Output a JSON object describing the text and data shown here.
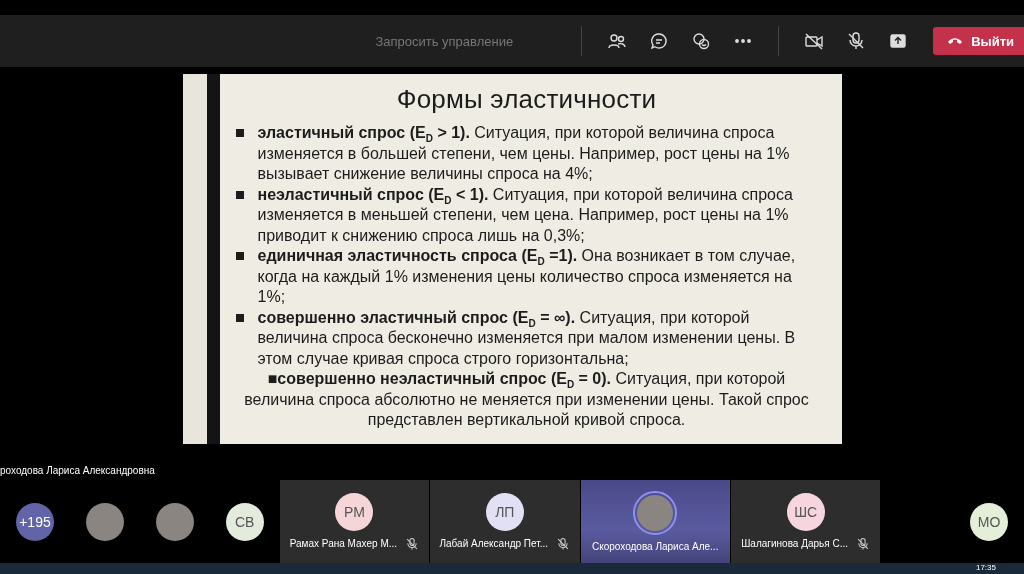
{
  "toolbar": {
    "request_control": {
      "label": "Запросить управление",
      "disabled": true
    },
    "leave_button": "Выйти"
  },
  "slide": {
    "title": "Формы эластичности",
    "items": [
      {
        "kind": "bullet",
        "text": "**эластичный спрос (E$_{D}$ > 1).** Ситуация, при которой величина спроса изменяется в большей степени, чем цены. Например, рост цены на 1% вызывает снижение величины спроса на 4%;"
      },
      {
        "kind": "bullet",
        "text": "**неэластичный спрос (E$_{D}$ < 1).** Ситуация, при которой величина спроса изменяется в меньшей степени, чем цена. Например, рост цены на 1% приводит к снижению спроса лишь на 0,3%;"
      },
      {
        "kind": "bullet",
        "text": "**единичная эластичность спроса (E$_{D}$ =1).** Она возникает в том случае, когда на каждый 1% изменения цены количество спроса изменяется на 1%;"
      },
      {
        "kind": "bullet",
        "text": "**совершенно эластичный спрос (E$_{D}$ = ∞).** Ситуация, при которой величина спроса бесконечно изменяется при малом изменении цены. В этом случае кривая спроса строго горизонтальна;"
      },
      {
        "kind": "centered",
        "text": "■**совершенно неэластичный спрос (E$_{D}$ = 0).** Ситуация, при которой величина спроса абсолютно не меняется при изменении цены. Такой спрос представлен вертикальной кривой спроса."
      }
    ]
  },
  "presenter_name": "роходова Лариса Александровна",
  "participants": [
    {
      "kind": "count",
      "label": "+195",
      "color": "#6264a7"
    },
    {
      "kind": "photo"
    },
    {
      "kind": "photo"
    },
    {
      "kind": "initials",
      "label": "СВ",
      "color": "#e3ebdc"
    },
    {
      "kind": "tile",
      "label": "РМ",
      "color": "#f6d5d9",
      "name": "Рамах Рана Махер М...",
      "muted": true,
      "selected": false
    },
    {
      "kind": "tile",
      "label": "ЛП",
      "color": "#e2e0f4",
      "name": "Лабай Александр Пет...",
      "muted": true,
      "selected": false
    },
    {
      "kind": "tile_photo",
      "name": "Скороходова Лариса Але...",
      "muted": false,
      "selected": true
    },
    {
      "kind": "tile",
      "label": "ШС",
      "color": "#f6d5df",
      "name": "Шалагинова Дарья С...",
      "muted": true,
      "selected": false
    },
    {
      "kind": "initials",
      "label": "МО",
      "color": "#e4eed8"
    }
  ],
  "taskbar": {
    "time": "17:35"
  }
}
